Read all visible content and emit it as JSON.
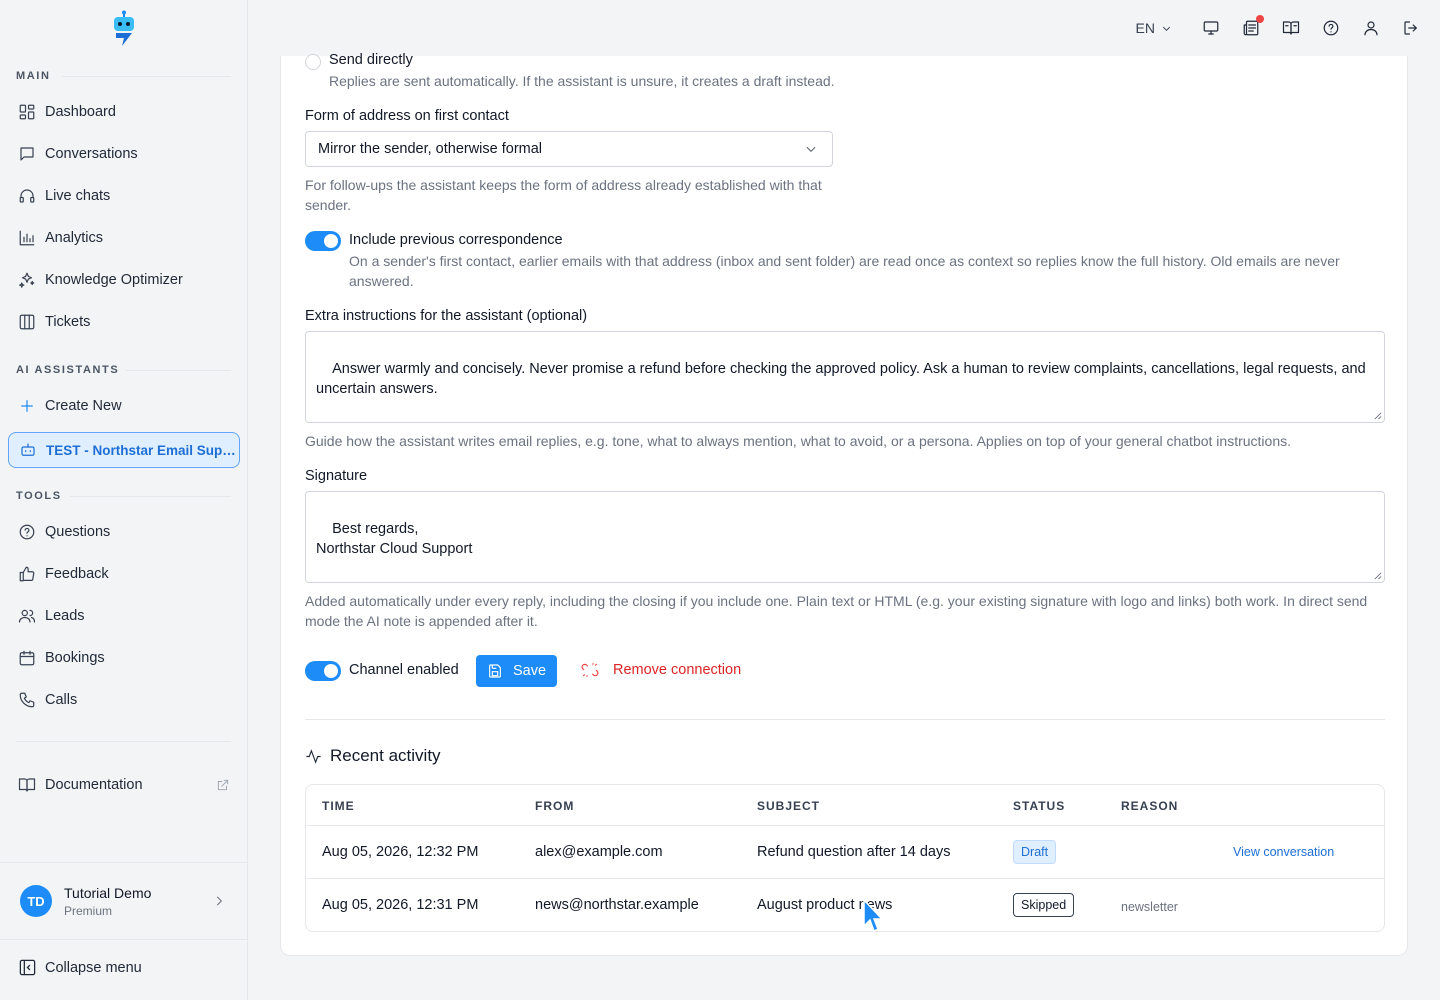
{
  "sidebar": {
    "sections": {
      "main": "MAIN",
      "ai": "AI ASSISTANTS",
      "tools": "TOOLS"
    },
    "main_items": [
      "Dashboard",
      "Conversations",
      "Live chats",
      "Analytics",
      "Knowledge Optimizer",
      "Tickets"
    ],
    "ai_items": [
      "Create New",
      "TEST - Northstar Email Support"
    ],
    "tools_items": [
      "Questions",
      "Feedback",
      "Leads",
      "Bookings",
      "Calls"
    ],
    "documentation": "Documentation",
    "user": {
      "initials": "TD",
      "name": "Tutorial Demo",
      "plan": "Premium"
    },
    "collapse": "Collapse menu"
  },
  "topbar": {
    "language": "EN"
  },
  "form": {
    "send_directly_label": "Send directly",
    "send_directly_help": "Replies are sent automatically. If the assistant is unsure, it creates a draft instead.",
    "address_label": "Form of address on first contact",
    "address_value": "Mirror the sender, otherwise formal",
    "address_help": "For follow-ups the assistant keeps the form of address already established with that sender.",
    "include_prev_label": "Include previous correspondence",
    "include_prev_help": "On a sender's first contact, earlier emails with that address (inbox and sent folder) are read once as context so replies know the full history. Old emails are never answered.",
    "extra_label": "Extra instructions for the assistant (optional)",
    "extra_value": "Answer warmly and concisely. Never promise a refund before checking the approved policy. Ask a human to review complaints, cancellations, legal requests, and uncertain answers.",
    "extra_help": "Guide how the assistant writes email replies, e.g. tone, what to always mention, what to avoid, or a persona. Applies on top of your general chatbot instructions.",
    "signature_label": "Signature",
    "signature_value": "Best regards,\nNorthstar Cloud Support",
    "signature_help": "Added automatically under every reply, including the closing if you include one. Plain text or HTML (e.g. your existing signature with logo and links) both work. In direct send mode the AI note is appended after it.",
    "channel_enabled_label": "Channel enabled",
    "save_label": "Save",
    "remove_label": "Remove connection"
  },
  "activity": {
    "title": "Recent activity",
    "columns": [
      "TIME",
      "FROM",
      "SUBJECT",
      "STATUS",
      "REASON"
    ],
    "rows": [
      {
        "time": "Aug 05, 2026, 12:32 PM",
        "from": "alex@example.com",
        "subject": "Refund question after 14 days",
        "status": "Draft",
        "reason": "",
        "action": "View conversation"
      },
      {
        "time": "Aug 05, 2026, 12:31 PM",
        "from": "news@northstar.example",
        "subject": "August product news",
        "status": "Skipped",
        "reason": "newsletter",
        "action": ""
      }
    ]
  },
  "colors": {
    "accent": "#1d8cf8",
    "danger": "#dc2626"
  }
}
